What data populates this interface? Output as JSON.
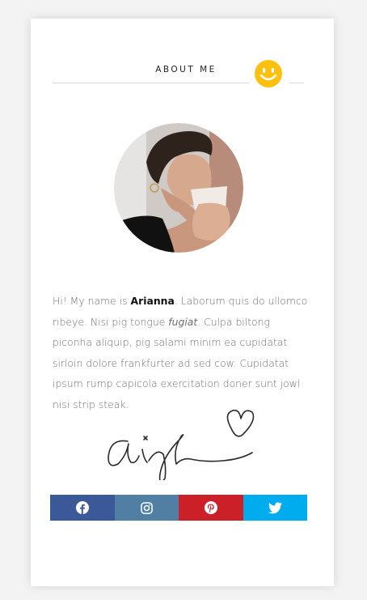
{
  "section_title": "ABOUT ME",
  "icons": {
    "title_badge": "smiley-face-icon",
    "signature": "handwritten-signature-with-heart",
    "social": [
      "facebook-icon",
      "instagram-icon",
      "pinterest-icon",
      "twitter-icon"
    ]
  },
  "colors": {
    "smiley": "#FDC00F",
    "facebook": "#3B5998",
    "instagram": "#517FA4",
    "pinterest": "#CB2027",
    "twitter": "#00ACED"
  },
  "bio": {
    "intro": "Hi! My name is ",
    "name": "Arianna",
    "part1": ". Laborum quis do ullomco ribeye. Nisi pig tongue ",
    "italic": "fugiat",
    "part2": ". Culpa biltong piconha aliquip, pig salami minim ea cupidatat sirloin dolore frankfurter ad sed cow. Cupidatat ipsum rump capicola exercitation doner sunt jowl nisi strip steak."
  }
}
